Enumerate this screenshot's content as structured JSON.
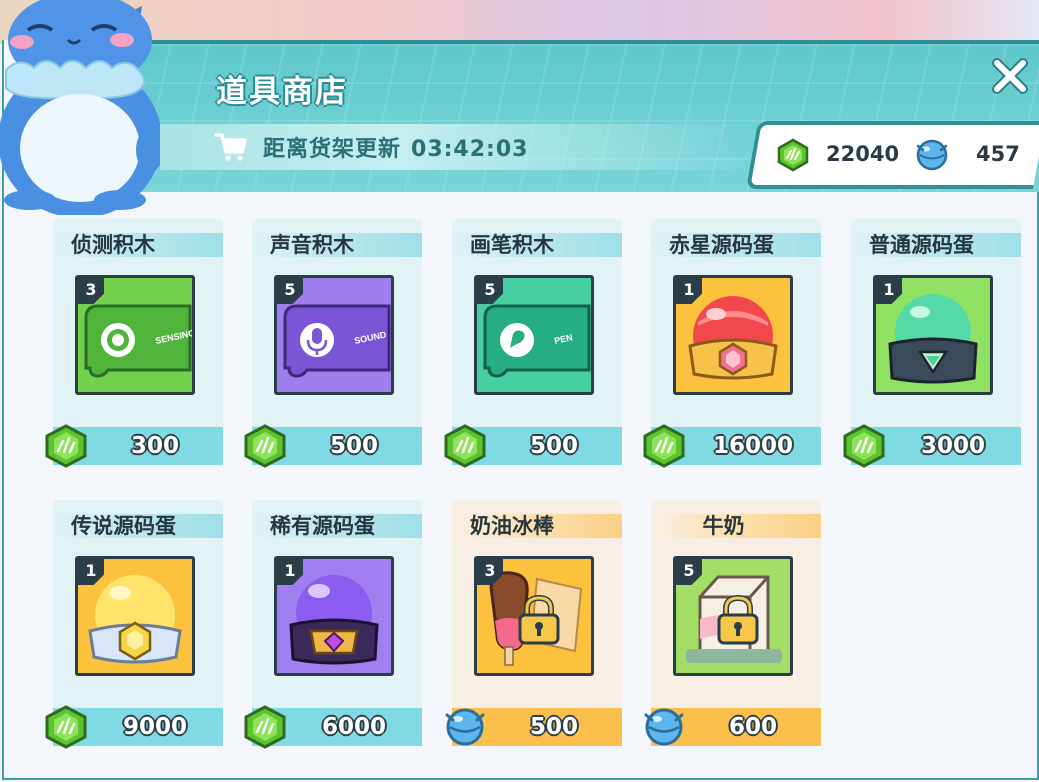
{
  "header": {
    "title": "道具商店",
    "timer_label": "距离货架更新",
    "timer_value": "03:42:03"
  },
  "currency": {
    "gems": "22040",
    "balls": "457"
  },
  "items": [
    {
      "name": "侦测积木",
      "level": "3",
      "price": "300",
      "currency": "gem",
      "locked": false,
      "icon": "sensing-block"
    },
    {
      "name": "声音积木",
      "level": "5",
      "price": "500",
      "currency": "gem",
      "locked": false,
      "icon": "sound-block"
    },
    {
      "name": "画笔积木",
      "level": "5",
      "price": "500",
      "currency": "gem",
      "locked": false,
      "icon": "pen-block"
    },
    {
      "name": "赤星源码蛋",
      "level": "1",
      "price": "16000",
      "currency": "gem",
      "locked": false,
      "icon": "red-star-egg"
    },
    {
      "name": "普通源码蛋",
      "level": "1",
      "price": "3000",
      "currency": "gem",
      "locked": false,
      "icon": "common-egg"
    },
    {
      "name": "传说源码蛋",
      "level": "1",
      "price": "9000",
      "currency": "gem",
      "locked": false,
      "icon": "legendary-egg"
    },
    {
      "name": "稀有源码蛋",
      "level": "1",
      "price": "6000",
      "currency": "gem",
      "locked": false,
      "icon": "rare-egg"
    },
    {
      "name": "奶油冰棒",
      "level": "3",
      "price": "500",
      "currency": "ball",
      "locked": true,
      "icon": "cream-popsicle"
    },
    {
      "name": "牛奶",
      "level": "5",
      "price": "600",
      "currency": "ball",
      "locked": true,
      "icon": "milk"
    }
  ],
  "block_labels": {
    "sensing": "SENSING",
    "sound": "SOUND",
    "pen": "PEN"
  }
}
